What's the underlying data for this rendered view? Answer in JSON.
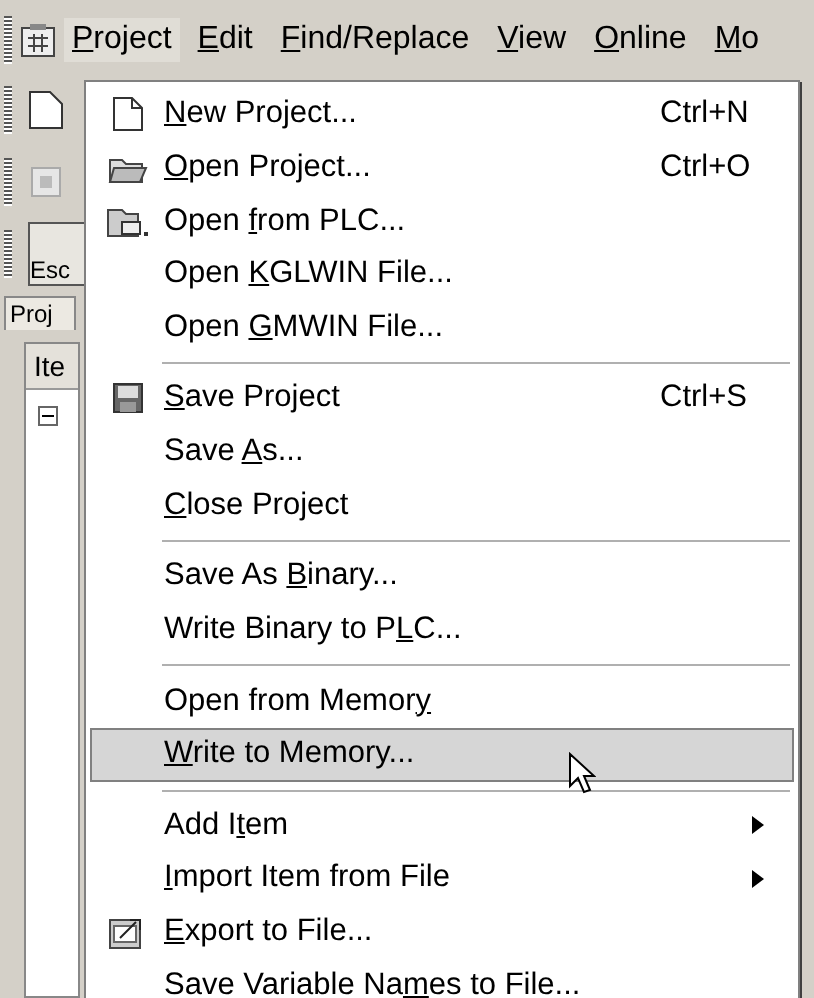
{
  "menubar": [
    {
      "key": "P",
      "post": "roject",
      "selected": true
    },
    {
      "key": "E",
      "post": "dit",
      "selected": false
    },
    {
      "key": "F",
      "post": "ind/Replace",
      "selected": false
    },
    {
      "key": "V",
      "post": "iew",
      "selected": false
    },
    {
      "key": "O",
      "post": "nline",
      "selected": false
    },
    {
      "key": "M",
      "post": "o",
      "selected": false
    }
  ],
  "background": {
    "button": "Esc",
    "tab": "Proj",
    "column": "Ite"
  },
  "menu": [
    {
      "kind": "item",
      "key": "N",
      "post": "ew Project...",
      "shortcut": "Ctrl+N",
      "selected": false
    },
    {
      "kind": "item",
      "key": "O",
      "post": "pen Project...",
      "shortcut": "Ctrl+O",
      "selected": false
    },
    {
      "kind": "item",
      "pre": "Open ",
      "key": "f",
      "post": "rom PLC...",
      "selected": false
    },
    {
      "kind": "item",
      "pre": "Open ",
      "key": "K",
      "post": "GLWIN File...",
      "selected": false
    },
    {
      "kind": "item",
      "pre": "Open ",
      "key": "G",
      "post": "MWIN File...",
      "selected": false
    },
    {
      "kind": "separator"
    },
    {
      "kind": "item",
      "key": "S",
      "post": "ave Project",
      "shortcut": "Ctrl+S",
      "selected": false
    },
    {
      "kind": "item",
      "pre": "Save ",
      "key": "A",
      "post": "s...",
      "selected": false
    },
    {
      "kind": "item",
      "key": "C",
      "post": "lose Project",
      "selected": false
    },
    {
      "kind": "separator"
    },
    {
      "kind": "item",
      "pre": "Save As ",
      "key": "B",
      "post": "inary...",
      "selected": false
    },
    {
      "kind": "item",
      "pre": "Write Binary to P",
      "key": "L",
      "post": "C...",
      "selected": false
    },
    {
      "kind": "separator"
    },
    {
      "kind": "item",
      "pre": "Open from Memor",
      "key": "y",
      "selected": false
    },
    {
      "kind": "item",
      "key": "W",
      "post": "rite to Memory...",
      "selected": true
    },
    {
      "kind": "separator"
    },
    {
      "kind": "submenu",
      "pre": "Add I",
      "key": "t",
      "post": "em",
      "selected": false
    },
    {
      "kind": "submenu",
      "key": "I",
      "post": "mport Item from File",
      "selected": false
    },
    {
      "kind": "item",
      "key": "E",
      "post": "xport to File...",
      "selected": false
    },
    {
      "kind": "item",
      "pre": "Save Variable Na",
      "key": "m",
      "post": "es to File...",
      "selected": false
    }
  ]
}
